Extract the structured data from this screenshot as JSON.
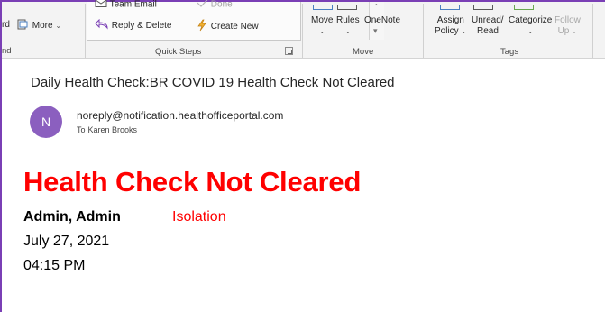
{
  "colors": {
    "frame": "#7a3fb5",
    "avatar": "#8b5fbf",
    "alert": "#ff0000",
    "ribbon_bg": "#f3f3f3",
    "icon_blue": "#4a7fc1"
  },
  "ribbon": {
    "left_cut": {
      "top": "rd",
      "bottom": "nd"
    },
    "more_label": "More",
    "quick_steps": {
      "team_email": "Team Email",
      "done": "Done",
      "reply_delete": "Reply & Delete",
      "create_new": "Create New",
      "group_label": "Quick Steps"
    },
    "move_group": {
      "move": "Move",
      "rules": "Rules",
      "onenote": "OneNote",
      "group_label": "Move"
    },
    "tags_group": {
      "assign_policy_line1": "Assign",
      "assign_policy_line2": "Policy",
      "unread_read_line1": "Unread/",
      "unread_read_line2": "Read",
      "categorize": "Categorize",
      "follow_up_line1": "Follow",
      "follow_up_line2": "Up",
      "group_label": "Tags"
    },
    "icons": [
      "more-icon",
      "team-email-icon",
      "done-icon",
      "reply-delete-icon",
      "create-new-icon",
      "move-icon",
      "rules-icon",
      "onenote-icon",
      "assign-policy-icon",
      "unread-read-icon",
      "categorize-icon",
      "follow-up-icon"
    ]
  },
  "message": {
    "subject": "Daily Health Check:BR COVID 19 Health Check Not Cleared",
    "avatar_initial": "N",
    "sender": "noreply@notification.healthofficeportal.com",
    "to_label": "To",
    "to_name": "Karen Brooks",
    "headline": "Health Check Not Cleared",
    "person": "Admin, Admin",
    "status": "Isolation",
    "date": "July 27, 2021",
    "time": "04:15 PM"
  }
}
